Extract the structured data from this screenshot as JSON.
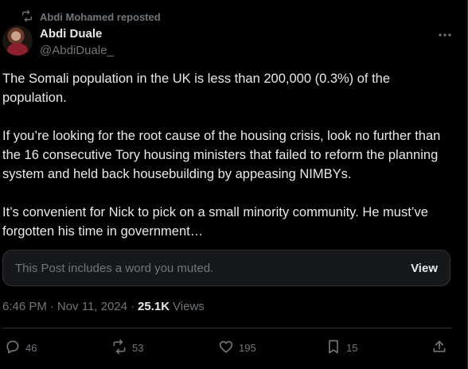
{
  "repost": {
    "label": "Abdi Mohamed reposted",
    "icon": "repost-icon"
  },
  "author": {
    "display_name": "Abdi Duale",
    "handle": "@AbdiDuale_",
    "avatar_icon": "avatar"
  },
  "post": {
    "paragraphs": [
      "The Somali population in the UK is less than 200,000 (0.3%) of the population.",
      "If you’re looking for the root cause of the housing crisis, look no further than the 16 consecutive Tory housing ministers that failed to reform the planning system and held back housebuilding by appeasing NIMBYs.",
      "It’s convenient for Nick to pick on a small minority community. He must’ve forgotten his time in government…"
    ]
  },
  "muted_notice": {
    "text": "This Post includes a word you muted.",
    "action": "View"
  },
  "meta": {
    "time": "6:46 PM",
    "separator": "·",
    "date": "Nov 11, 2024",
    "views_count": "25.1K",
    "views_label": "Views"
  },
  "actions": {
    "replies": "46",
    "reposts": "53",
    "likes": "195",
    "bookmarks": "15"
  },
  "colors": {
    "background": "#000000",
    "text": "#e7e9ea",
    "secondary": "#71767b",
    "border": "#2f3336"
  }
}
